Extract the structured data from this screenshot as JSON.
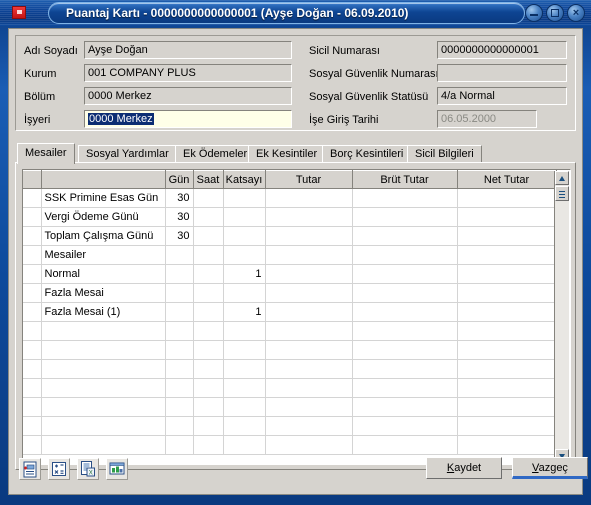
{
  "window": {
    "title": "Puantaj Kartı - 0000000000000001 (Ayşe Doğan - 06.09.2010)",
    "app_icon": "red-square-app-icon",
    "buttons": {
      "minimize": "minimize-icon",
      "maximize": "maximize-icon",
      "close": "×"
    }
  },
  "form": {
    "left": [
      {
        "label": "Adı Soyadı",
        "value": "Ayşe Doğan"
      },
      {
        "label": "Kurum",
        "value": "001 COMPANY PLUS"
      },
      {
        "label": "Bölüm",
        "value": "0000 Merkez"
      },
      {
        "label": "İşyeri",
        "value": "0000 Merkez"
      }
    ],
    "right": [
      {
        "label": "Sicil Numarası",
        "value": "0000000000000001"
      },
      {
        "label": "Sosyal Güvenlik Numarası",
        "value": ""
      },
      {
        "label": "Sosyal Güvenlik Statüsü",
        "value": "4/a Normal"
      },
      {
        "label": "İşe Giriş Tarihi",
        "value": "06.05.2000"
      }
    ]
  },
  "tabs": [
    {
      "label": "Mesailer",
      "active": true
    },
    {
      "label": "Sosyal Yardımlar",
      "active": false
    },
    {
      "label": "Ek Ödemeler",
      "active": false
    },
    {
      "label": "Ek Kesintiler",
      "active": false
    },
    {
      "label": "Borç Kesintileri",
      "active": false
    },
    {
      "label": "Sicil Bilgileri",
      "active": false
    }
  ],
  "grid": {
    "columns": [
      "",
      "",
      "Gün",
      "Saat",
      "Katsayı",
      "Tutar",
      "Brüt Tutar",
      "Net Tutar"
    ],
    "rows": [
      {
        "desc": "SSK Primine Esas Gün",
        "indent": 0,
        "gun": "30",
        "saat": "",
        "katsayi": "",
        "tutar": "",
        "brut": "",
        "net": ""
      },
      {
        "desc": "Vergi Ödeme Günü",
        "indent": 0,
        "gun": "30",
        "saat": "",
        "katsayi": "",
        "tutar": "",
        "brut": "",
        "net": ""
      },
      {
        "desc": "Toplam Çalışma Günü",
        "indent": 0,
        "gun": "30",
        "saat": "",
        "katsayi": "",
        "tutar": "",
        "brut": "",
        "net": ""
      },
      {
        "desc": "Mesailer",
        "indent": 0,
        "gun": "",
        "saat": "",
        "katsayi": "",
        "tutar": "",
        "brut": "",
        "net": ""
      },
      {
        "desc": "Normal",
        "indent": 1,
        "gun": "",
        "saat": "",
        "katsayi": "1",
        "tutar": "",
        "brut": "",
        "net": ""
      },
      {
        "desc": "Fazla Mesai",
        "indent": 0,
        "gun": "",
        "saat": "",
        "katsayi": "",
        "tutar": "",
        "brut": "",
        "net": ""
      },
      {
        "desc": "Fazla Mesai (1)",
        "indent": 1,
        "gun": "",
        "saat": "",
        "katsayi": "1",
        "tutar": "",
        "brut": "",
        "net": ""
      },
      {
        "desc": "",
        "indent": 0,
        "gun": "",
        "saat": "",
        "katsayi": "",
        "tutar": "",
        "brut": "",
        "net": ""
      },
      {
        "desc": "",
        "indent": 0,
        "gun": "",
        "saat": "",
        "katsayi": "",
        "tutar": "",
        "brut": "",
        "net": ""
      },
      {
        "desc": "",
        "indent": 0,
        "gun": "",
        "saat": "",
        "katsayi": "",
        "tutar": "",
        "brut": "",
        "net": ""
      },
      {
        "desc": "",
        "indent": 0,
        "gun": "",
        "saat": "",
        "katsayi": "",
        "tutar": "",
        "brut": "",
        "net": ""
      },
      {
        "desc": "",
        "indent": 0,
        "gun": "",
        "saat": "",
        "katsayi": "",
        "tutar": "",
        "brut": "",
        "net": ""
      },
      {
        "desc": "",
        "indent": 0,
        "gun": "",
        "saat": "",
        "katsayi": "",
        "tutar": "",
        "brut": "",
        "net": ""
      },
      {
        "desc": "",
        "indent": 0,
        "gun": "",
        "saat": "",
        "katsayi": "",
        "tutar": "",
        "brut": "",
        "net": ""
      }
    ]
  },
  "toolbar": [
    {
      "icon": "document-add-icon"
    },
    {
      "icon": "calculator-icon"
    },
    {
      "icon": "report-export-icon"
    },
    {
      "icon": "chart-window-icon"
    }
  ],
  "actions": {
    "save": {
      "label": "Kaydet",
      "accel": "K",
      "rest": "aydet",
      "focused": false
    },
    "cancel": {
      "label": "Vazgeç",
      "accel": "V",
      "rest": "azgeç",
      "focused": true
    }
  },
  "colors": {
    "title_blue": "#0d4396",
    "face": "#d6d3ce",
    "focus_field": "#ffffe8",
    "selection": "#0c2d73",
    "focus_underline": "#2f68c4"
  }
}
